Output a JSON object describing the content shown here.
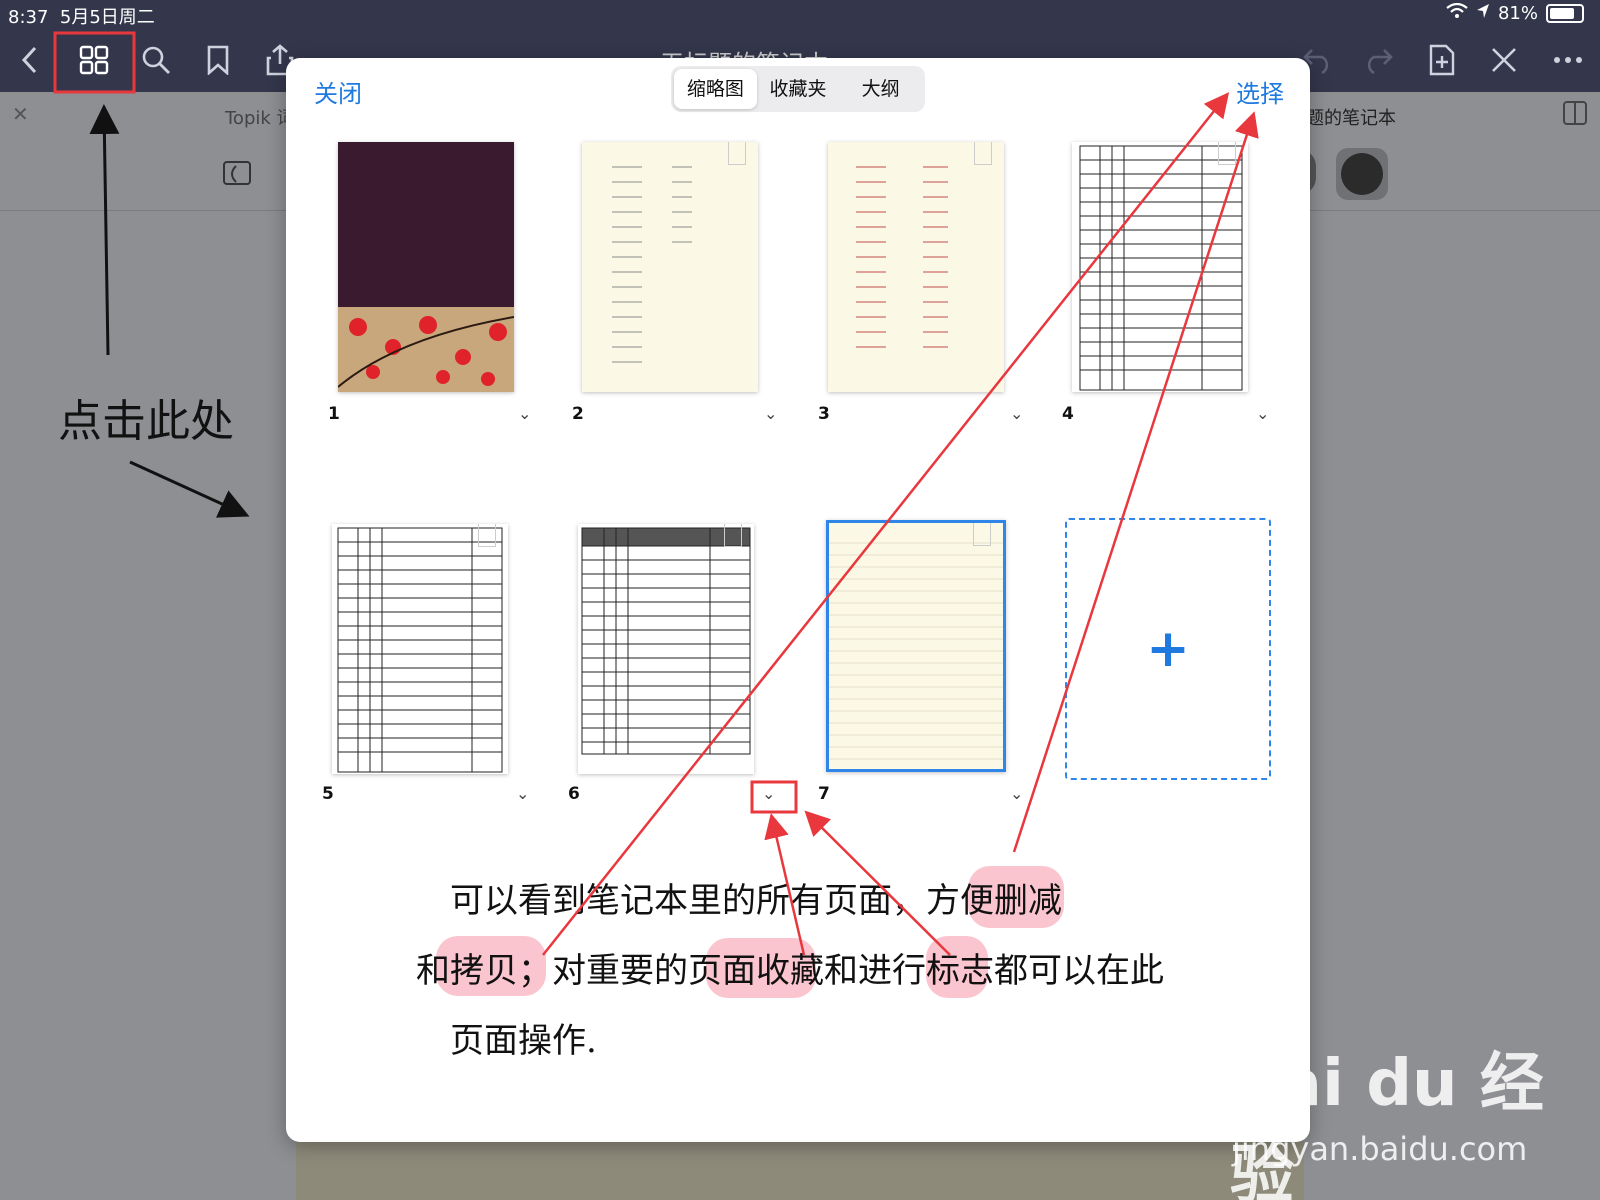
{
  "status": {
    "time": "8:37",
    "date": "5月5日周二",
    "battery": "81%"
  },
  "toolbar": {
    "title": "无标题的笔记本"
  },
  "tabs": {
    "tab_left": "Topik 词",
    "tab_right": "题的笔记本"
  },
  "modal": {
    "close_label": "关闭",
    "select_label": "选择",
    "segments": [
      "缩略图",
      "收藏夹",
      "大纲"
    ],
    "pages": [
      "1",
      "2",
      "3",
      "4",
      "5",
      "6",
      "7"
    ],
    "add_label": "+"
  },
  "annotations": {
    "click_here": "点击此处",
    "line1": "可以看到笔记本里的所有页面，方便删减",
    "line2": "和拷贝；对重要的页面收藏和进行标志都可以在此",
    "line3": "页面操作."
  },
  "watermark": {
    "brand": "Bai du 经验",
    "url": "jingyan.baidu.com"
  },
  "colors": {
    "accent": "#1f7ae0",
    "annotation_red": "#e8383d",
    "toolbar": "#34374c"
  }
}
